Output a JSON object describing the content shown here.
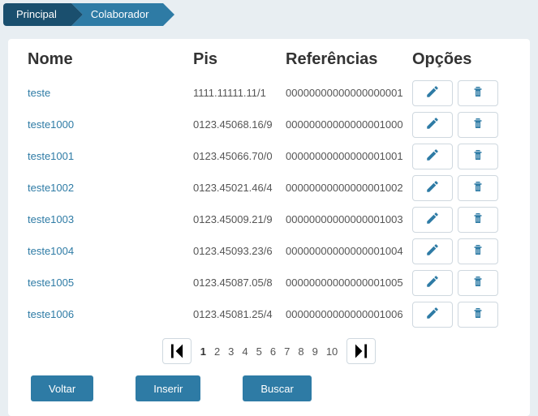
{
  "breadcrumb": {
    "home": "Principal",
    "current": "Colaborador"
  },
  "headers": {
    "nome": "Nome",
    "pis": "Pis",
    "ref": "Referências",
    "opt": "Opções"
  },
  "rows": [
    {
      "nome": "teste",
      "pis": "1111.11111.11/1",
      "ref": "00000000000000000001"
    },
    {
      "nome": "teste1000",
      "pis": "0123.45068.16/9",
      "ref": "00000000000000001000"
    },
    {
      "nome": "teste1001",
      "pis": "0123.45066.70/0",
      "ref": "00000000000000001001"
    },
    {
      "nome": "teste1002",
      "pis": "0123.45021.46/4",
      "ref": "00000000000000001002"
    },
    {
      "nome": "teste1003",
      "pis": "0123.45009.21/9",
      "ref": "00000000000000001003"
    },
    {
      "nome": "teste1004",
      "pis": "0123.45093.23/6",
      "ref": "00000000000000001004"
    },
    {
      "nome": "teste1005",
      "pis": "0123.45087.05/8",
      "ref": "00000000000000001005"
    },
    {
      "nome": "teste1006",
      "pis": "0123.45081.25/4",
      "ref": "00000000000000001006"
    }
  ],
  "pager": {
    "first_icon": "first",
    "last_icon": "last",
    "pages": [
      "1",
      "2",
      "3",
      "4",
      "5",
      "6",
      "7",
      "8",
      "9",
      "10"
    ],
    "current": "1"
  },
  "buttons": {
    "back": "Voltar",
    "insert": "Inserir",
    "search": "Buscar"
  }
}
